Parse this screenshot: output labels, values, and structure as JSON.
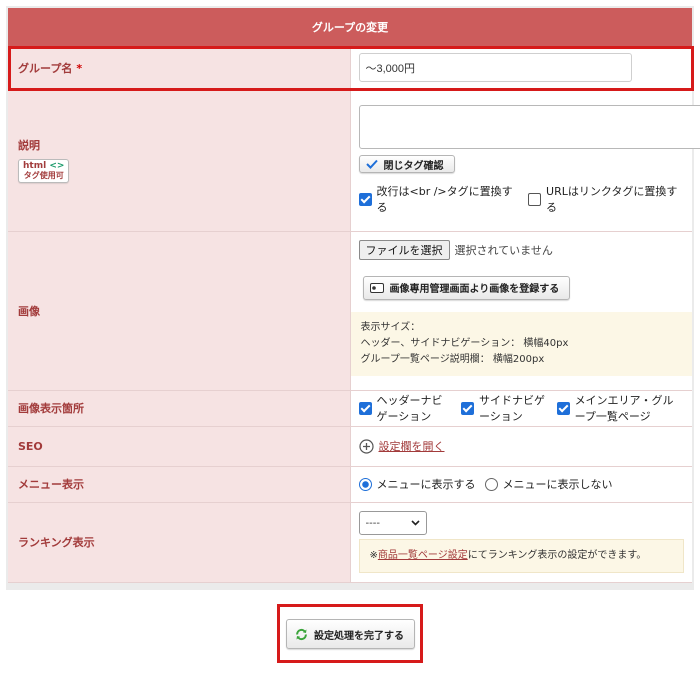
{
  "form": {
    "title": "グループの変更",
    "group_name": {
      "label": "グループ名",
      "required_mark": "*",
      "value": "〜3,000円"
    },
    "description": {
      "label": "説明",
      "badge_html": "html",
      "badge_brackets": "<>",
      "badge_sub": "タグ使用可",
      "check_tags_button": "閉じタグ確認",
      "br_replace_label": "改行は<br />タグに置換する",
      "url_replace_label": "URLはリンクタグに置換する"
    },
    "image": {
      "label": "画像",
      "file_button": "ファイルを選択",
      "file_status": "選択されていません",
      "register_button": "画像専用管理画面より画像を登録する",
      "note_title": "表示サイズ：",
      "note_line1": "ヘッダー、サイドナビゲーション： 横幅40px",
      "note_line2": "グループ一覧ページ説明欄： 横幅200px"
    },
    "display_location": {
      "label": "画像表示箇所",
      "option1": "ヘッダーナビゲーション",
      "option2": "サイドナビゲーション",
      "option3": "メインエリア・グループ一覧ページ"
    },
    "seo": {
      "label": "SEO",
      "open_link": "設定欄を開く"
    },
    "menu": {
      "label": "メニュー表示",
      "option_show": "メニューに表示する",
      "option_hide": "メニューに表示しない"
    },
    "ranking": {
      "label": "ランキング表示",
      "select_value": "----",
      "note_prefix": "※",
      "note_link": "商品一覧ページ設定",
      "note_suffix": "にてランキング表示の設定ができます。"
    }
  },
  "submit_button": "設定処理を完了する",
  "colors": {
    "header": "#cc5c5c",
    "label_bg": "#f6e3e3",
    "label_text": "#a23b3b",
    "highlight": "#d61a1a",
    "checkbox": "#1e6fd9",
    "submit_icon": "#3aa43a"
  }
}
